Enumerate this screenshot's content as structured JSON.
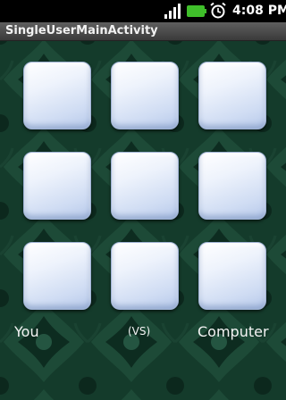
{
  "status_bar": {
    "time": "4:08 PM",
    "icons": [
      "signal-icon",
      "battery-icon",
      "alarm-clock-icon"
    ],
    "battery_color": "#3fbf2a"
  },
  "title_bar": {
    "title": "SingleUserMainActivity"
  },
  "board": {
    "rows": 3,
    "cols": 3,
    "cells": [
      "",
      "",
      "",
      "",
      "",
      "",
      "",
      "",
      ""
    ]
  },
  "players": {
    "left_label": "You",
    "vs_label": "(VS)",
    "right_label": "Computer"
  },
  "colors": {
    "background": "#143b2b",
    "cell_face": "#dfe8f8"
  }
}
